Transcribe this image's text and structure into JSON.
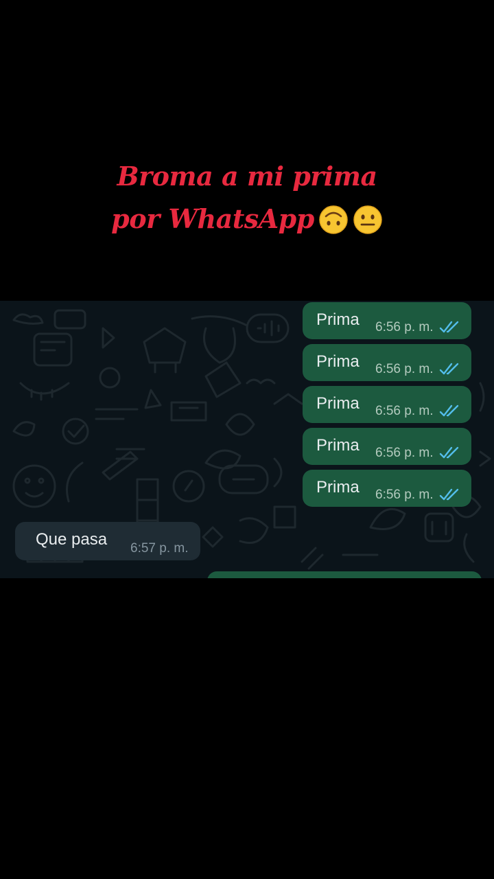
{
  "caption": {
    "line1": "Broma a mi prima",
    "line2": "por WhatsApp",
    "emojis": [
      "upside-down-face-emoji",
      "neutral-face-emoji"
    ]
  },
  "chat": {
    "outgoing": [
      {
        "text": "Prima",
        "time": "6:56 p. m.",
        "status": "read"
      },
      {
        "text": "Prima",
        "time": "6:56 p. m.",
        "status": "read"
      },
      {
        "text": "Prima",
        "time": "6:56 p. m.",
        "status": "read"
      },
      {
        "text": "Prima",
        "time": "6:56 p. m.",
        "status": "read"
      },
      {
        "text": "Prima",
        "time": "6:56 p. m.",
        "status": "read"
      }
    ],
    "incoming": [
      {
        "text": "Que pasa",
        "time": "6:57 p. m."
      }
    ]
  },
  "colors": {
    "caption": "#e8293f",
    "chat_background": "#0b141a",
    "outgoing_bubble": "#1c5a3f",
    "incoming_bubble": "#1f2c34",
    "read_ticks": "#53bdeb"
  }
}
